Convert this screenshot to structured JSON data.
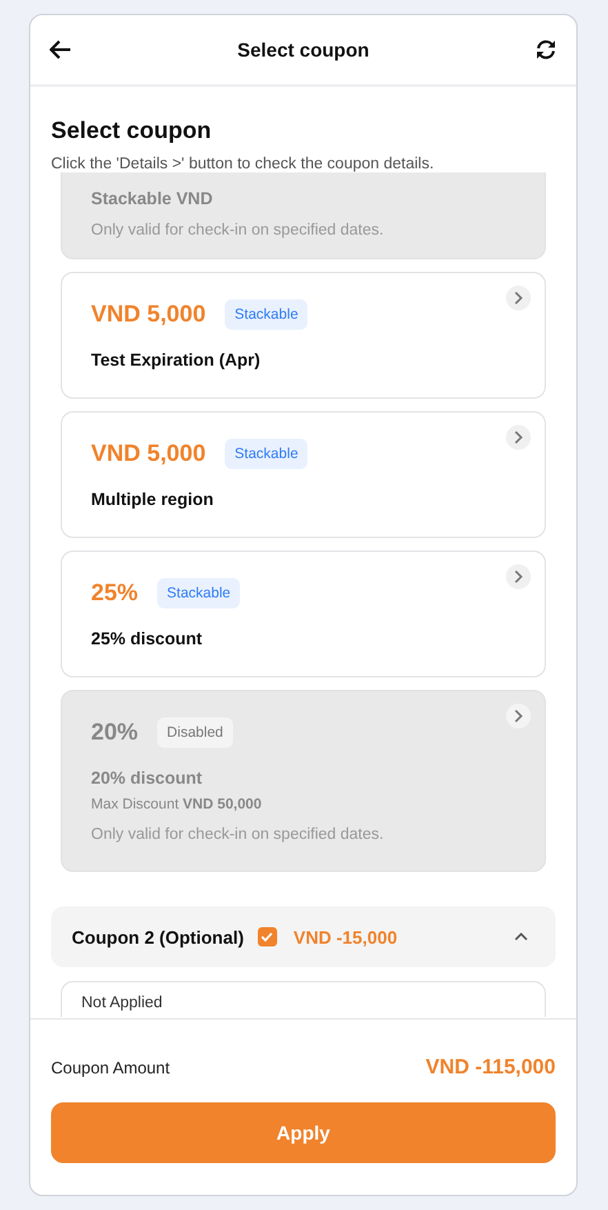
{
  "header": {
    "title": "Select coupon"
  },
  "section": {
    "title": "Select coupon",
    "hint": "Click the 'Details >' button to check the coupon details."
  },
  "coupons": [
    {
      "title": "Stackable VND",
      "note": "Only valid for check-in on specified dates.",
      "disabled": true
    },
    {
      "amount": "VND 5,000",
      "badge": "Stackable",
      "title": "Test Expiration (Apr)",
      "disabled": false
    },
    {
      "amount": "VND 5,000",
      "badge": "Stackable",
      "title": "Multiple region",
      "disabled": false
    },
    {
      "amount": "25%",
      "badge": "Stackable",
      "title": "25% discount",
      "disabled": false
    },
    {
      "amount": "20%",
      "badge": "Disabled",
      "title": "20% discount",
      "max_discount": "Max Discount **VND 50,000**",
      "note": "Only valid for check-in on specified dates.",
      "disabled": true
    }
  ],
  "coupon2": {
    "label": "Coupon 2 (Optional)",
    "checked": true,
    "amount": "VND -15,000",
    "expanded": true,
    "options": [
      {
        "label": "Not Applied"
      }
    ]
  },
  "footer": {
    "label": "Coupon Amount",
    "amount": "VND -115,000",
    "button": "Apply"
  }
}
